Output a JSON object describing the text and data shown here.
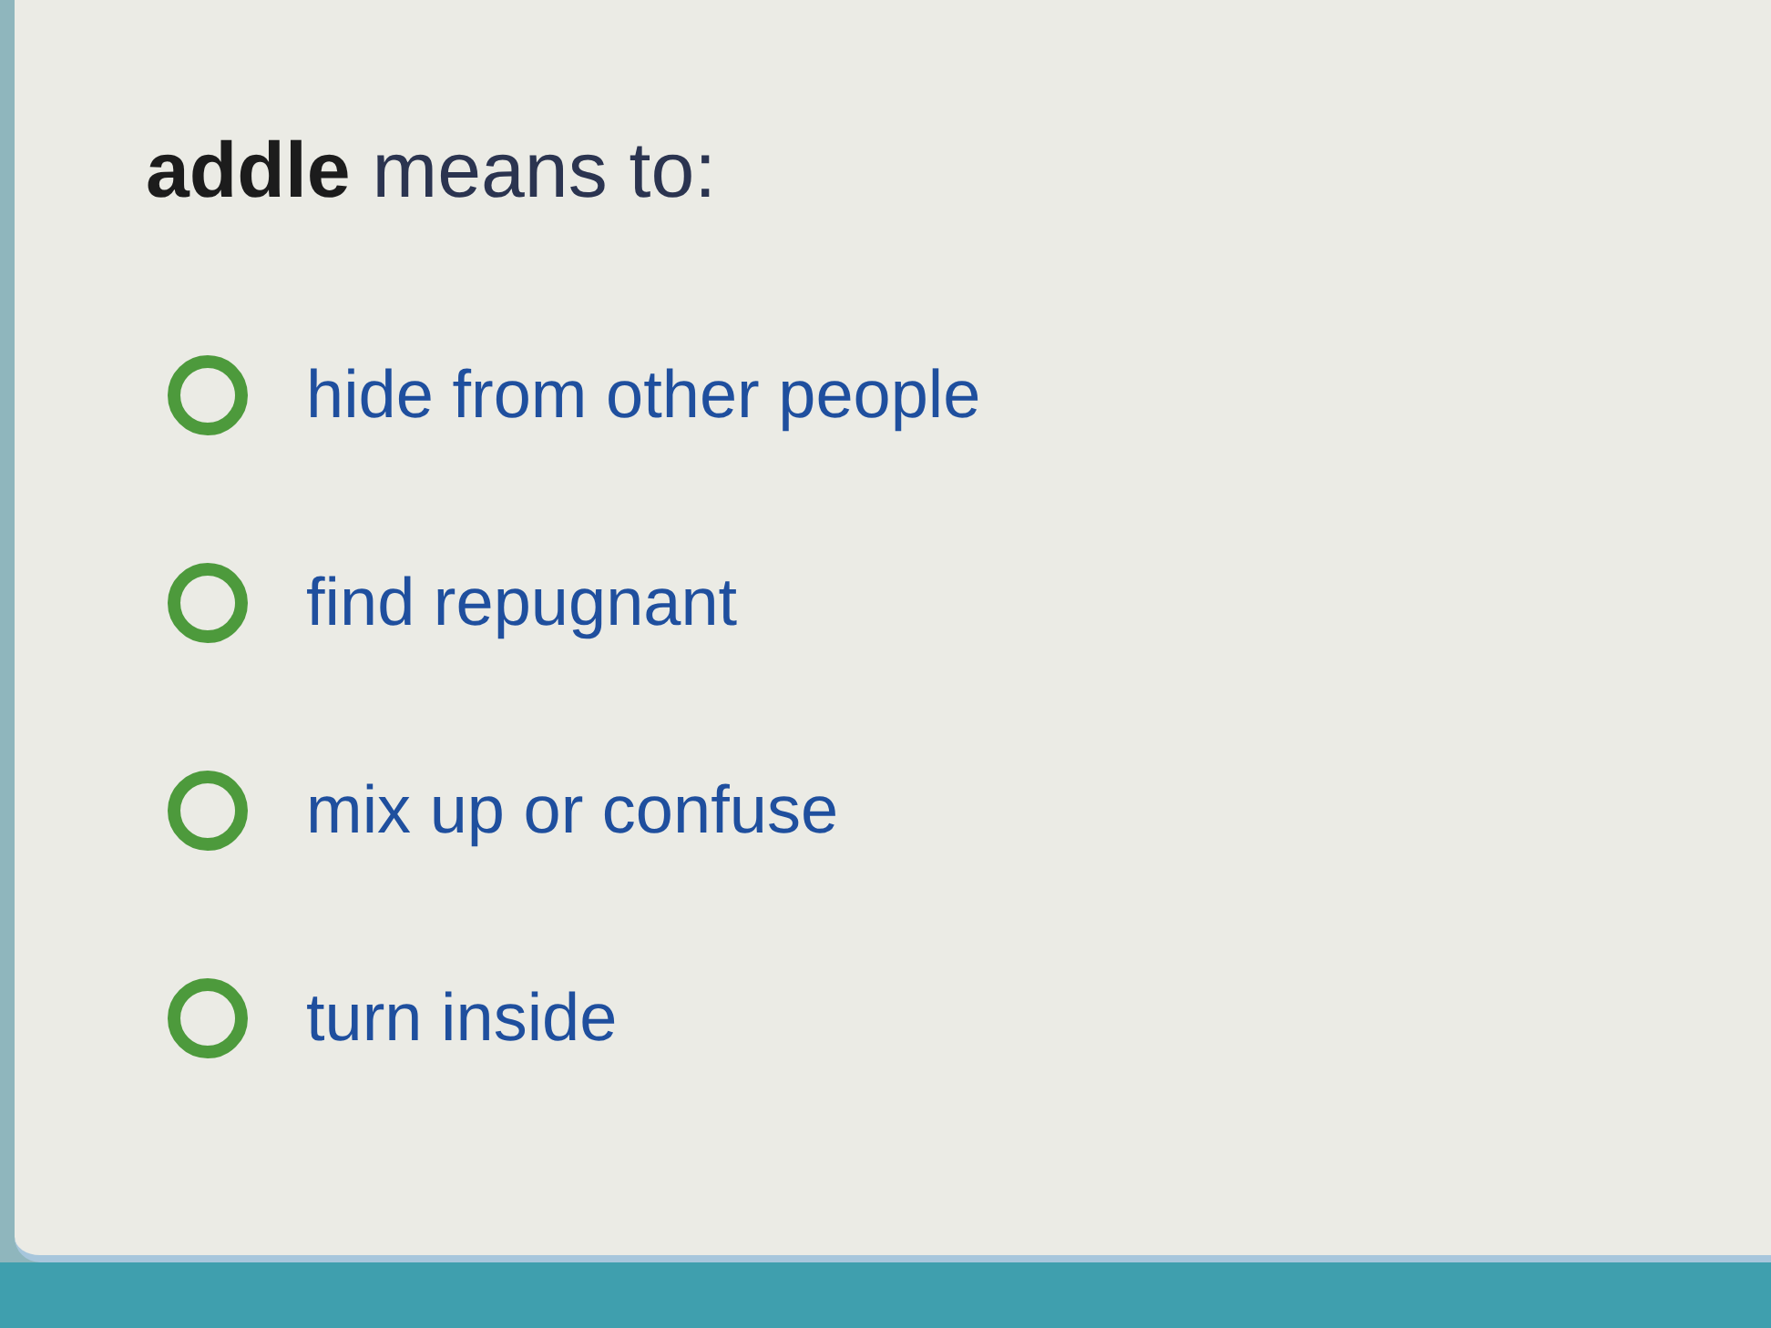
{
  "question": {
    "text": "**addle** means to:"
  },
  "options": [
    {
      "label": "hide from other people",
      "selected": false
    },
    {
      "label": "find repugnant",
      "selected": false
    },
    {
      "label": "mix up or confuse",
      "selected": false
    },
    {
      "label": "turn inside",
      "selected": false
    }
  ]
}
